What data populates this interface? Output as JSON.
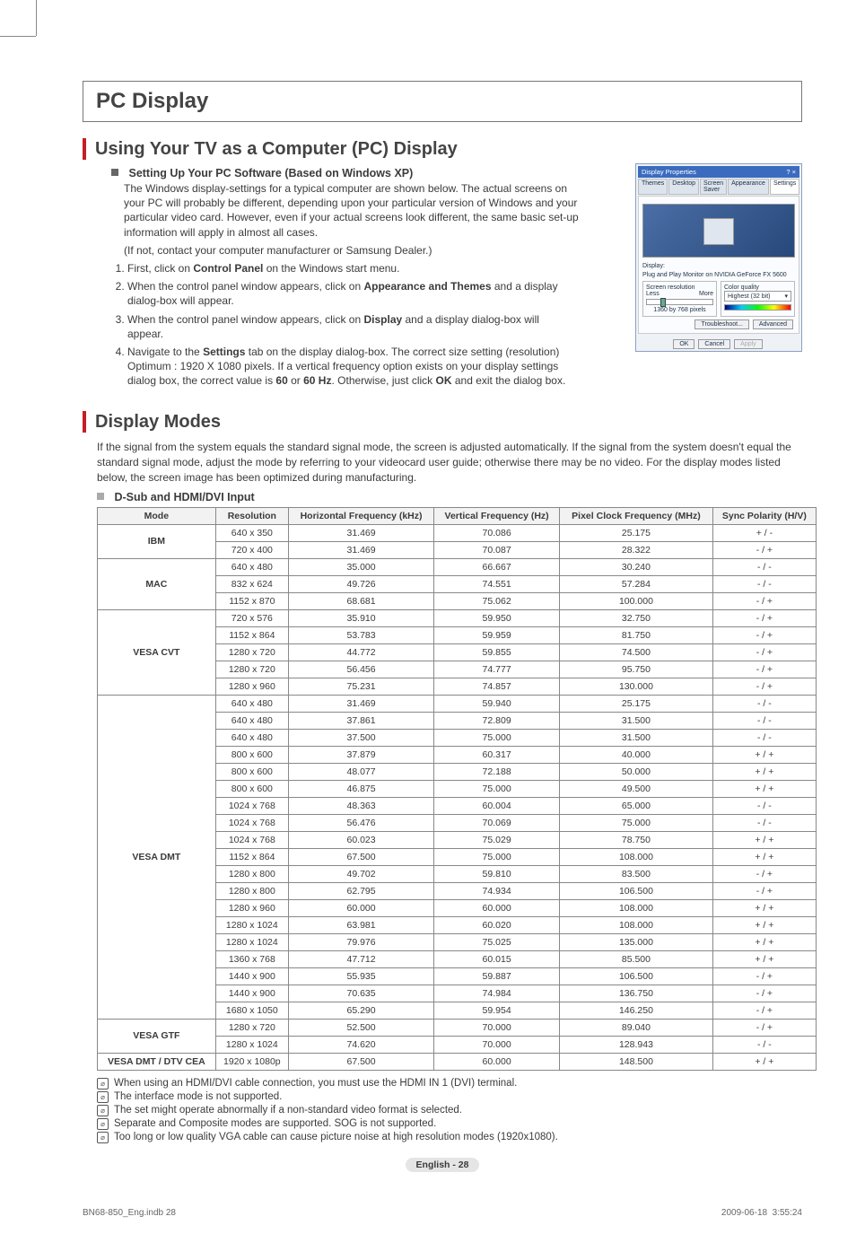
{
  "title": "PC Display",
  "section1": {
    "heading": "Using Your TV as a Computer (PC) Display",
    "sub_heading": "Setting Up Your PC Software (Based on Windows XP)",
    "para1": "The Windows display-settings for a typical computer are shown below. The actual screens on your PC will probably be different, depending upon your particular version of Windows and your particular video card. However, even if your actual screens look different, the same basic set-up information will apply in almost all cases.",
    "para2": "(If not, contact your computer manufacturer or Samsung Dealer.)",
    "steps": [
      {
        "pre": "First, click on ",
        "b": "Control Panel",
        "post": " on the Windows start menu."
      },
      {
        "pre": "When the control panel window appears, click on ",
        "b": "Appearance and Themes",
        "post": " and a display dialog-box will appear."
      },
      {
        "pre": "When the control panel window appears, click on ",
        "b": "Display",
        "post": " and a display dialog-box will appear."
      },
      {
        "pre": "Navigate to the ",
        "b": "Settings",
        "post": " tab on the display dialog-box. The correct size setting (resolution) Optimum : 1920 X 1080 pixels. If a vertical frequency option exists on your display settings dialog box, the correct value is ",
        "b2": "60",
        "mid": " or ",
        "b3": "60 Hz",
        "post2": ". Otherwise, just click ",
        "b4": "OK",
        "post3": " and exit the dialog box."
      }
    ],
    "dialog": {
      "title": "Display Properties",
      "tabs": [
        "Themes",
        "Desktop",
        "Screen Saver",
        "Appearance",
        "Settings"
      ],
      "display_label": "Display:",
      "display_value": "Plug and Play Monitor on NVIDIA GeForce FX 5600",
      "group_res": "Screen resolution",
      "less": "Less",
      "more": "More",
      "res_value": "1360 by 768 pixels",
      "group_color": "Color quality",
      "color_value": "Highest (32 bit)",
      "btn_trouble": "Troubleshoot...",
      "btn_adv": "Advanced",
      "btn_ok": "OK",
      "btn_cancel": "Cancel",
      "btn_apply": "Apply"
    }
  },
  "section2": {
    "heading": "Display Modes",
    "intro": "If the signal from the system equals the standard signal mode, the screen is adjusted automatically. If the signal from the system doesn't equal the standard signal mode, adjust the mode by referring to your videocard user guide; otherwise there may be no video. For the display modes listed below, the screen image has been optimized during manufacturing.",
    "sub_heading": "D-Sub and HDMI/DVI Input",
    "columns": [
      "Mode",
      "Resolution",
      "Horizontal Frequency (kHz)",
      "Vertical Frequency (Hz)",
      "Pixel Clock Frequency (MHz)",
      "Sync Polarity (H/V)"
    ],
    "groups": [
      {
        "mode": "IBM",
        "rows": [
          [
            "640 x 350",
            "31.469",
            "70.086",
            "25.175",
            "+ / -"
          ],
          [
            "720 x 400",
            "31.469",
            "70.087",
            "28.322",
            "- / +"
          ]
        ]
      },
      {
        "mode": "MAC",
        "rows": [
          [
            "640 x 480",
            "35.000",
            "66.667",
            "30.240",
            "- / -"
          ],
          [
            "832 x 624",
            "49.726",
            "74.551",
            "57.284",
            "- / -"
          ],
          [
            "1152 x 870",
            "68.681",
            "75.062",
            "100.000",
            "- / +"
          ]
        ]
      },
      {
        "mode": "VESA CVT",
        "rows": [
          [
            "720 x 576",
            "35.910",
            "59.950",
            "32.750",
            "- / +"
          ],
          [
            "1152 x 864",
            "53.783",
            "59.959",
            "81.750",
            "- / +"
          ],
          [
            "1280 x 720",
            "44.772",
            "59.855",
            "74.500",
            "- / +"
          ],
          [
            "1280 x 720",
            "56.456",
            "74.777",
            "95.750",
            "- / +"
          ],
          [
            "1280 x 960",
            "75.231",
            "74.857",
            "130.000",
            "- / +"
          ]
        ]
      },
      {
        "mode": "VESA DMT",
        "rows": [
          [
            "640 x 480",
            "31.469",
            "59.940",
            "25.175",
            "- / -"
          ],
          [
            "640 x 480",
            "37.861",
            "72.809",
            "31.500",
            "- / -"
          ],
          [
            "640 x 480",
            "37.500",
            "75.000",
            "31.500",
            "- / -"
          ],
          [
            "800 x 600",
            "37.879",
            "60.317",
            "40.000",
            "+ / +"
          ],
          [
            "800 x 600",
            "48.077",
            "72.188",
            "50.000",
            "+ / +"
          ],
          [
            "800 x 600",
            "46.875",
            "75.000",
            "49.500",
            "+ / +"
          ],
          [
            "1024 x 768",
            "48.363",
            "60.004",
            "65.000",
            "- / -"
          ],
          [
            "1024 x 768",
            "56.476",
            "70.069",
            "75.000",
            "- / -"
          ],
          [
            "1024 x 768",
            "60.023",
            "75.029",
            "78.750",
            "+ / +"
          ],
          [
            "1152 x 864",
            "67.500",
            "75.000",
            "108.000",
            "+ / +"
          ],
          [
            "1280 x 800",
            "49.702",
            "59.810",
            "83.500",
            "- / +"
          ],
          [
            "1280 x 800",
            "62.795",
            "74.934",
            "106.500",
            "- / +"
          ],
          [
            "1280 x 960",
            "60.000",
            "60.000",
            "108.000",
            "+ / +"
          ],
          [
            "1280 x 1024",
            "63.981",
            "60.020",
            "108.000",
            "+ / +"
          ],
          [
            "1280 x 1024",
            "79.976",
            "75.025",
            "135.000",
            "+ / +"
          ],
          [
            "1360 x 768",
            "47.712",
            "60.015",
            "85.500",
            "+ / +"
          ],
          [
            "1440 x 900",
            "55.935",
            "59.887",
            "106.500",
            "- / +"
          ],
          [
            "1440 x 900",
            "70.635",
            "74.984",
            "136.750",
            "- / +"
          ],
          [
            "1680 x 1050",
            "65.290",
            "59.954",
            "146.250",
            "- / +"
          ]
        ]
      },
      {
        "mode": "VESA GTF",
        "rows": [
          [
            "1280 x 720",
            "52.500",
            "70.000",
            "89.040",
            "- / +"
          ],
          [
            "1280 x 1024",
            "74.620",
            "70.000",
            "128.943",
            "- / -"
          ]
        ]
      },
      {
        "mode": "VESA DMT / DTV CEA",
        "rows": [
          [
            "1920 x 1080p",
            "67.500",
            "60.000",
            "148.500",
            "+ / +"
          ]
        ]
      }
    ],
    "notes": [
      "When using an HDMI/DVI cable connection, you must use the HDMI IN 1 (DVI) terminal.",
      "The interface mode is not supported.",
      "The set might operate abnormally if a non-standard video format is selected.",
      "Separate and Composite modes are supported. SOG is not supported.",
      "Too long or low quality VGA cable can cause picture noise at high resolution modes (1920x1080)."
    ]
  },
  "footer": {
    "page_label": "English - 28",
    "doc_ref": "BN68-850_Eng.indb   28",
    "timestamp": "2009-06-18   ﻿﻿ 3:55:24"
  }
}
